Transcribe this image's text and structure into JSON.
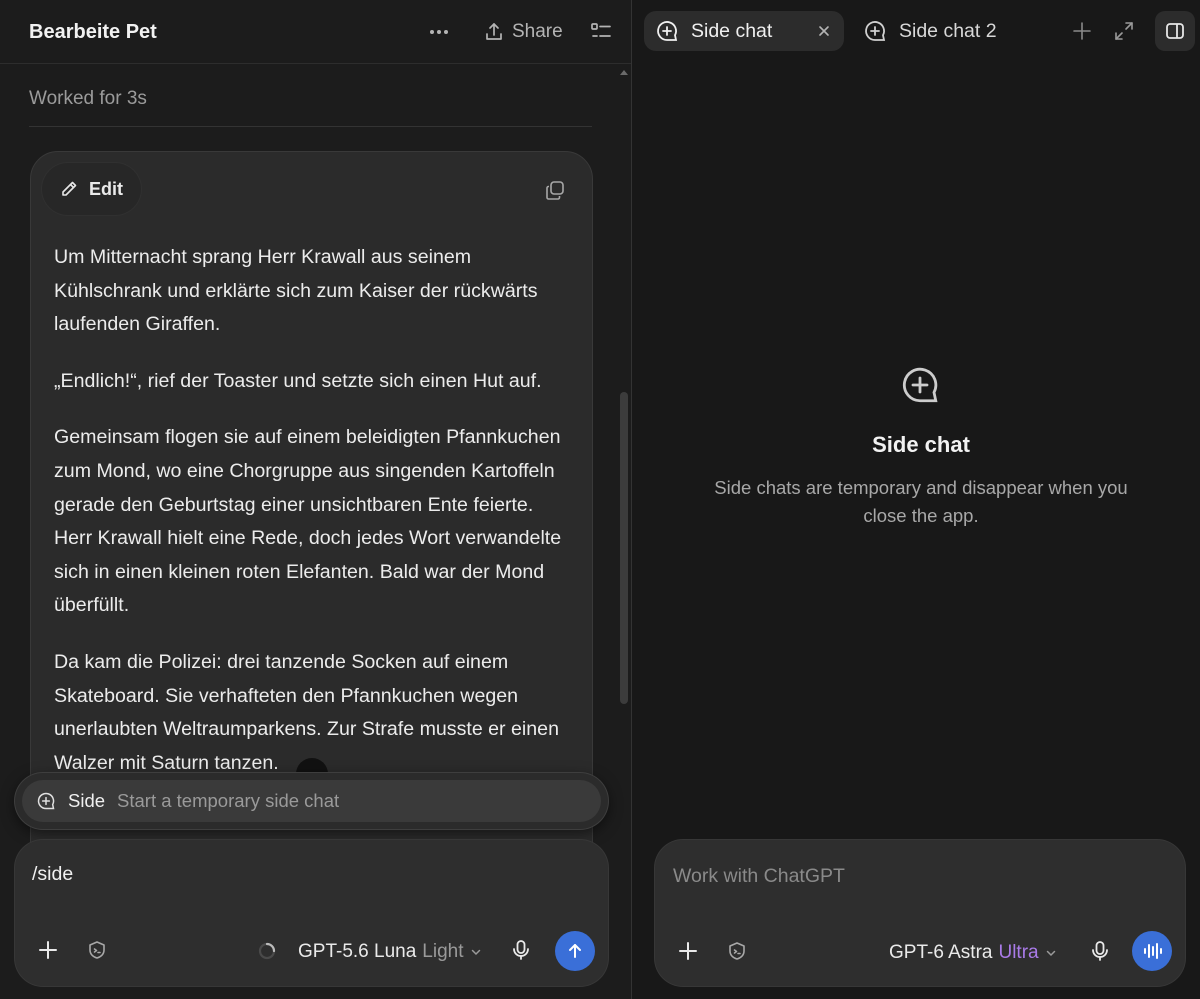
{
  "colors": {
    "accent_blue": "#3a6fd8",
    "ultra_purple": "#a97be8",
    "background": "#181818",
    "card": "#2b2b2b"
  },
  "left_pane": {
    "header": {
      "title": "Bearbeite Pet",
      "more_icon": "ellipsis-icon",
      "share_label": "Share",
      "share_icon": "share-icon",
      "list_icon": "list-icon"
    },
    "status": "Worked for 3s",
    "message": {
      "edit_label": "Edit",
      "edit_icon": "pencil-icon",
      "copy_icon": "copy-icon",
      "paragraphs": [
        "Um Mitternacht sprang Herr Krawall aus seinem Kühlschrank und erklärte sich zum Kaiser der rückwärts laufenden Giraffen.",
        "„Endlich!“, rief der Toaster und setzte sich einen Hut auf.",
        "Gemeinsam flogen sie auf einem beleidigten Pfannkuchen zum Mond, wo eine Chorgruppe aus singenden Kartoffeln gerade den Geburtstag einer unsichtbaren Ente feierte. Herr Krawall hielt eine Rede, doch jedes Wort verwandelte sich in einen kleinen roten Elefanten. Bald war der Mond überfüllt.",
        "Da kam die Polizei: drei tanzende Socken auf einem Skateboard. Sie verhafteten den Pfannkuchen wegen unerlaubten Weltraumparkens. Zur Strafe musste er einen Walzer mit Saturn tanzen."
      ]
    },
    "suggestion": {
      "command": "Side",
      "description": "Start a temporary side chat",
      "icon": "side-chat-icon"
    },
    "composer": {
      "input_value": "/side",
      "model_name": "GPT-5.6 Luna",
      "model_tier": "Light",
      "plus_icon": "plus-icon",
      "tools_icon": "tools-icon",
      "mic_icon": "mic-icon",
      "send_icon": "arrow-up-icon"
    }
  },
  "right_pane": {
    "tabs": [
      {
        "label": "Side chat",
        "active": true,
        "icon": "side-chat-icon"
      },
      {
        "label": "Side chat 2",
        "active": false,
        "icon": "side-chat-icon"
      }
    ],
    "empty_state": {
      "title": "Side chat",
      "description": "Side chats are temporary and disappear when you close the app."
    },
    "composer": {
      "placeholder": "Work with ChatGPT",
      "model_name": "GPT-6 Astra",
      "model_tier": "Ultra",
      "plus_icon": "plus-icon",
      "tools_icon": "tools-icon",
      "mic_icon": "mic-icon",
      "voice_icon": "voice-waveform-icon"
    }
  }
}
